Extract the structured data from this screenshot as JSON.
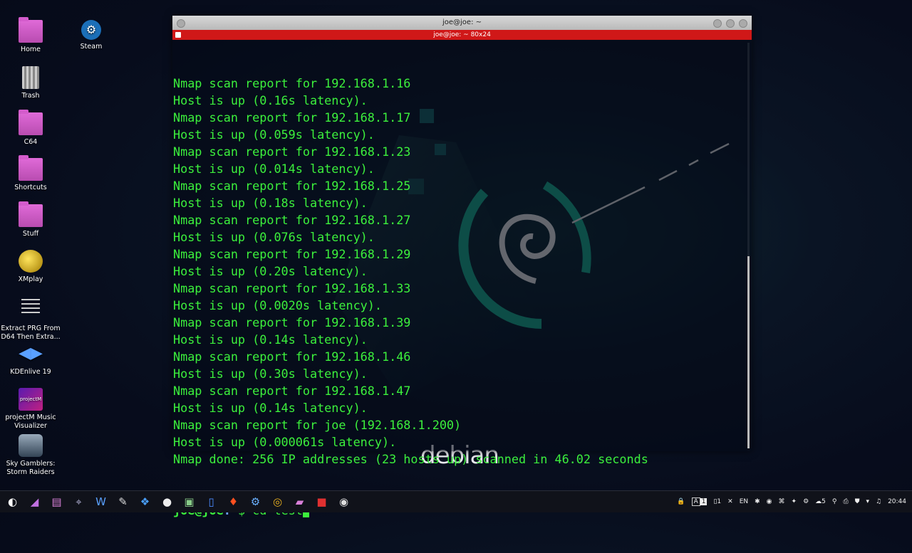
{
  "desktop": {
    "icons": [
      {
        "label": "Home",
        "icon": "home-folder-icon"
      },
      {
        "label": "Steam",
        "icon": "steam-icon"
      },
      {
        "label": "Trash",
        "icon": "trash-icon"
      },
      {
        "label": "C64",
        "icon": "folder-icon"
      },
      {
        "label": "Shortcuts",
        "icon": "folder-icon"
      },
      {
        "label": "Stuff",
        "icon": "folder-icon"
      },
      {
        "label": "XMplay",
        "icon": "xmplay-icon"
      },
      {
        "label": "Extract PRG From D64 Then Extra...",
        "icon": "document-icon"
      },
      {
        "label": "KDEnlive 19",
        "icon": "kdenlive-icon"
      },
      {
        "label": "projectM Music Visualizer",
        "icon": "projectm-icon"
      },
      {
        "label": "Sky Gamblers: Storm Raiders",
        "icon": "sky-gamblers-icon"
      }
    ],
    "wallpaper_word": "debian"
  },
  "terminal": {
    "window_title": "joe@joe: ~",
    "tab_title": "joe@joe: ~ 80x24",
    "lines": [
      "Nmap scan report for 192.168.1.16",
      "Host is up (0.16s latency).",
      "Nmap scan report for 192.168.1.17",
      "Host is up (0.059s latency).",
      "Nmap scan report for 192.168.1.23",
      "Host is up (0.014s latency).",
      "Nmap scan report for 192.168.1.25",
      "Host is up (0.18s latency).",
      "Nmap scan report for 192.168.1.27",
      "Host is up (0.076s latency).",
      "Nmap scan report for 192.168.1.29",
      "Host is up (0.20s latency).",
      "Nmap scan report for 192.168.1.33",
      "Host is up (0.0020s latency).",
      "Nmap scan report for 192.168.1.39",
      "Host is up (0.14s latency).",
      "Nmap scan report for 192.168.1.46",
      "Host is up (0.30s latency).",
      "Nmap scan report for 192.168.1.47",
      "Host is up (0.14s latency).",
      "Nmap scan report for joe (192.168.1.200)",
      "Host is up (0.000061s latency).",
      "Nmap done: 256 IP addresses (23 hosts up) scanned in 46.02 seconds"
    ],
    "prompt_user": "joe@joe",
    "prompt_path": ":~",
    "prompt_symbol": "$",
    "command": " cd test"
  },
  "taskbar": {
    "apps": [
      "start-icon",
      "kde-icon",
      "files-icon",
      "gamepad-icon",
      "word-icon",
      "notes-icon",
      "kdenlive-icon",
      "circle-icon",
      "terminal-icon",
      "doc-icon",
      "brave-icon",
      "steam-icon",
      "chrome-icon",
      "folder-icon",
      "screen-recorder-icon",
      "obs-icon"
    ],
    "tray": {
      "lock": "🔒",
      "desktop_a": "A",
      "desktop_num": "1",
      "copy_count": "1",
      "close": "✕",
      "language": "EN",
      "wifi_count": "5",
      "time": "20:44"
    }
  }
}
